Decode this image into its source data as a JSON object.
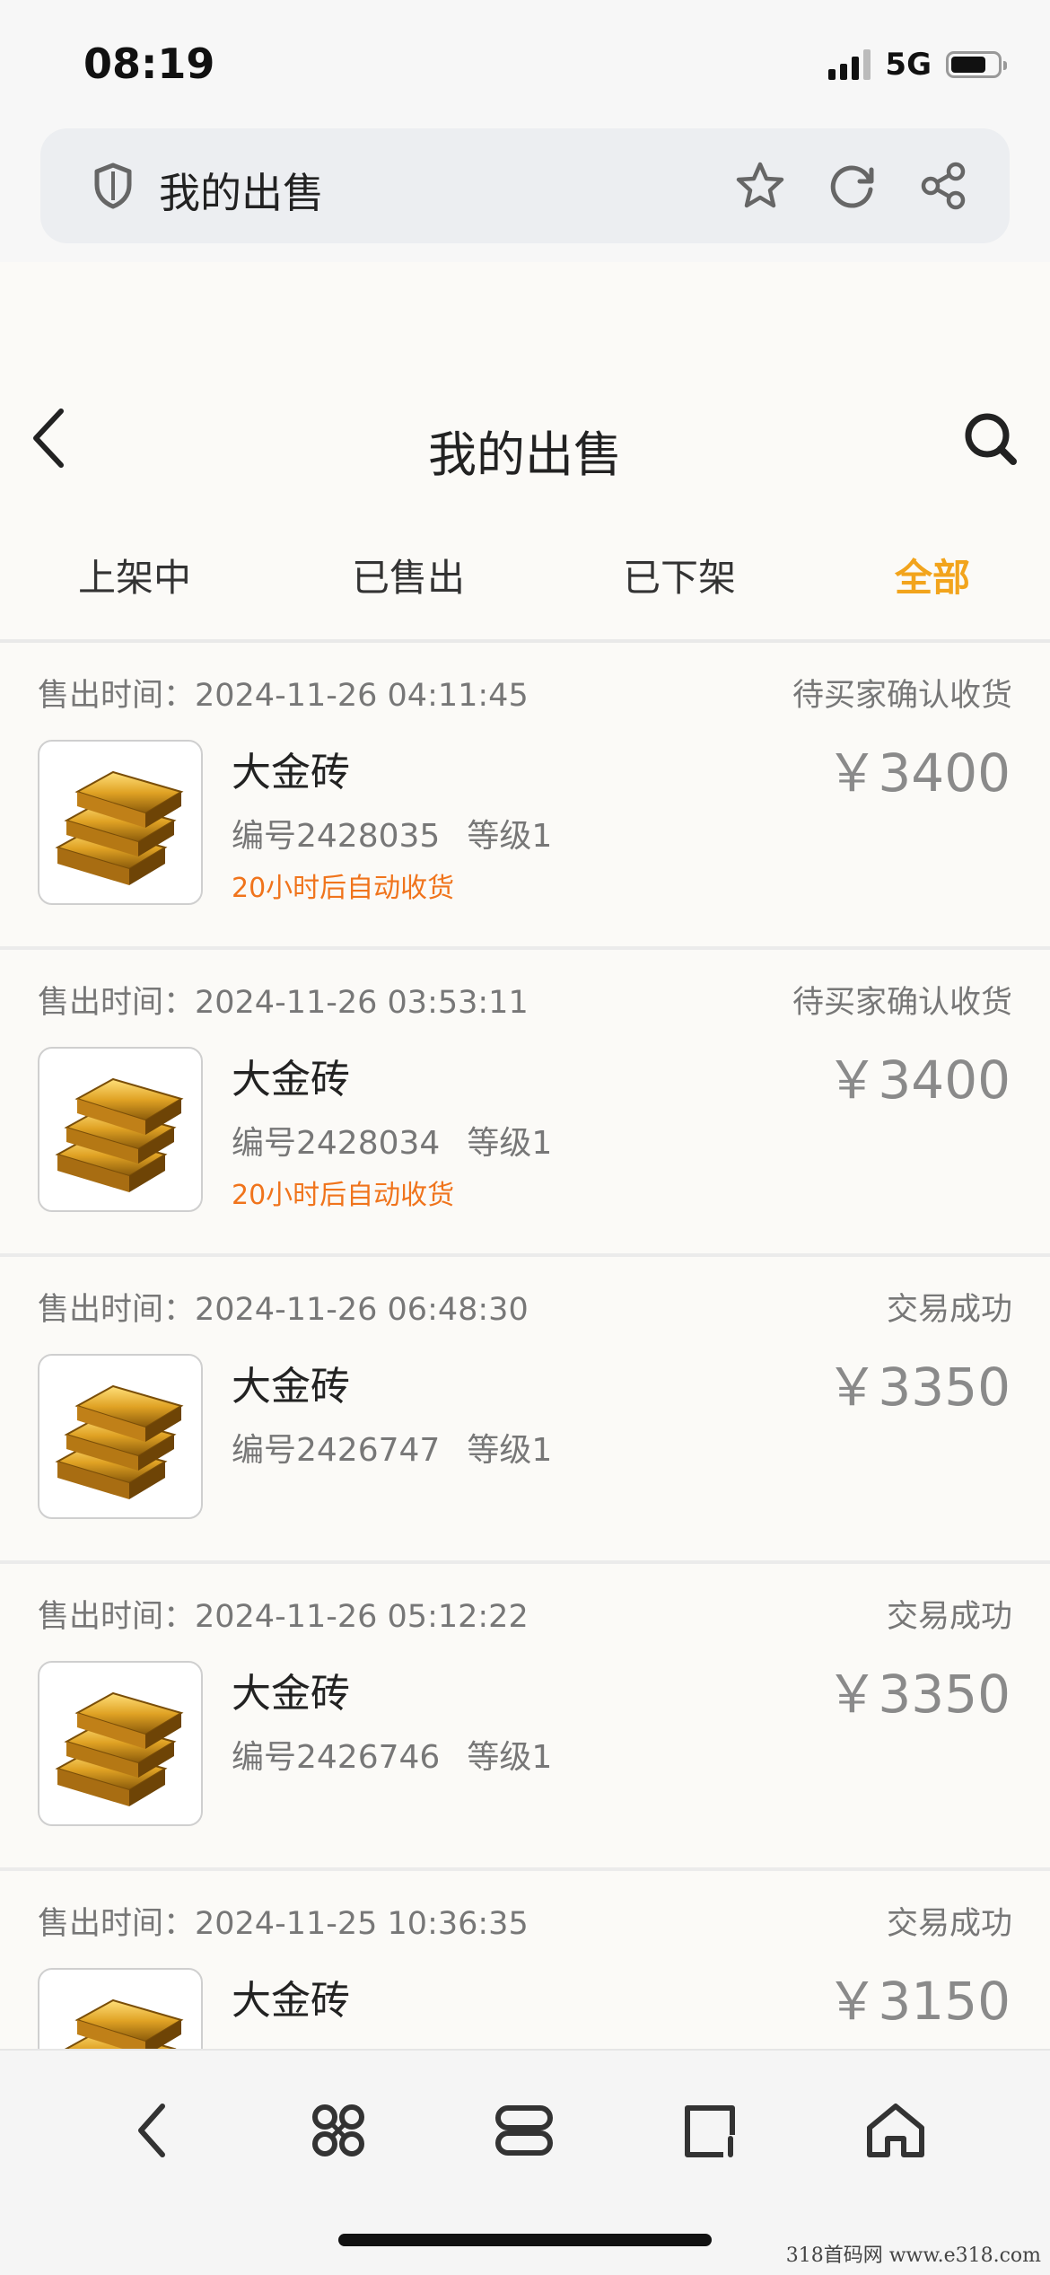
{
  "status_bar": {
    "time": "08:19",
    "network": "5G"
  },
  "browser": {
    "address_title": "我的出售"
  },
  "header": {
    "title": "我的出售"
  },
  "tabs": [
    {
      "label": "上架中",
      "active": false
    },
    {
      "label": "已售出",
      "active": false
    },
    {
      "label": "已下架",
      "active": false
    },
    {
      "label": "全部",
      "active": true
    }
  ],
  "orders": [
    {
      "sell_time": "售出时间：2024-11-26 04:11:45",
      "status": "待买家确认收货",
      "name": "大金砖",
      "serial": "编号2428035",
      "level": "等级1",
      "note": "20小时后自动收货",
      "price": "￥3400"
    },
    {
      "sell_time": "售出时间：2024-11-26 03:53:11",
      "status": "待买家确认收货",
      "name": "大金砖",
      "serial": "编号2428034",
      "level": "等级1",
      "note": "20小时后自动收货",
      "price": "￥3400"
    },
    {
      "sell_time": "售出时间：2024-11-26 06:48:30",
      "status": "交易成功",
      "name": "大金砖",
      "serial": "编号2426747",
      "level": "等级1",
      "note": "",
      "price": "￥3350"
    },
    {
      "sell_time": "售出时间：2024-11-26 05:12:22",
      "status": "交易成功",
      "name": "大金砖",
      "serial": "编号2426746",
      "level": "等级1",
      "note": "",
      "price": "￥3350"
    },
    {
      "sell_time": "售出时间：2024-11-25 10:36:35",
      "status": "交易成功",
      "name": "大金砖",
      "serial": "",
      "level": "",
      "note": "",
      "price": "￥3150"
    }
  ],
  "watermark": "318首码网  www.e318.com",
  "colors": {
    "accent": "#f2a41c",
    "note": "#f0741c",
    "background": "#fbfaf7"
  },
  "icons": [
    "shield-icon",
    "star-icon",
    "refresh-icon",
    "share-icon",
    "back-icon",
    "search-icon",
    "gold-bar-icon",
    "toolbar-back-icon",
    "apps-icon",
    "tabs-icon",
    "edit-icon",
    "home-icon"
  ]
}
